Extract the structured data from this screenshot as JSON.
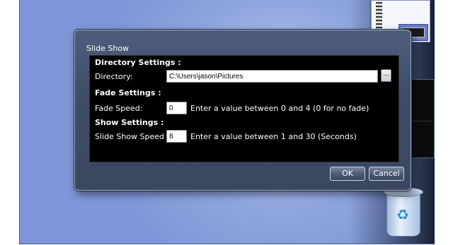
{
  "dialog": {
    "title": "Slide Show",
    "directory_section": "Directory Settings :",
    "directory_label": "Directory:",
    "directory_value": "C:\\Users\\jason\\Pictures",
    "browse_label": "...",
    "fade_section": "Fade Settings :",
    "fade_label": "Fade Speed:",
    "fade_value": "0",
    "fade_hint": "Enter a value between 0 and 4 (0 for no fade)",
    "show_section": "Show Settings :",
    "show_label": "Slide Show Speed :",
    "show_value": "8",
    "show_hint": "Enter a value between 1 and 30 (Seconds)",
    "ok_label": "OK",
    "cancel_label": "Cancel"
  },
  "icons": [
    "recycle-bin-icon",
    "desktop-thumbnail",
    "photo-gadget"
  ]
}
